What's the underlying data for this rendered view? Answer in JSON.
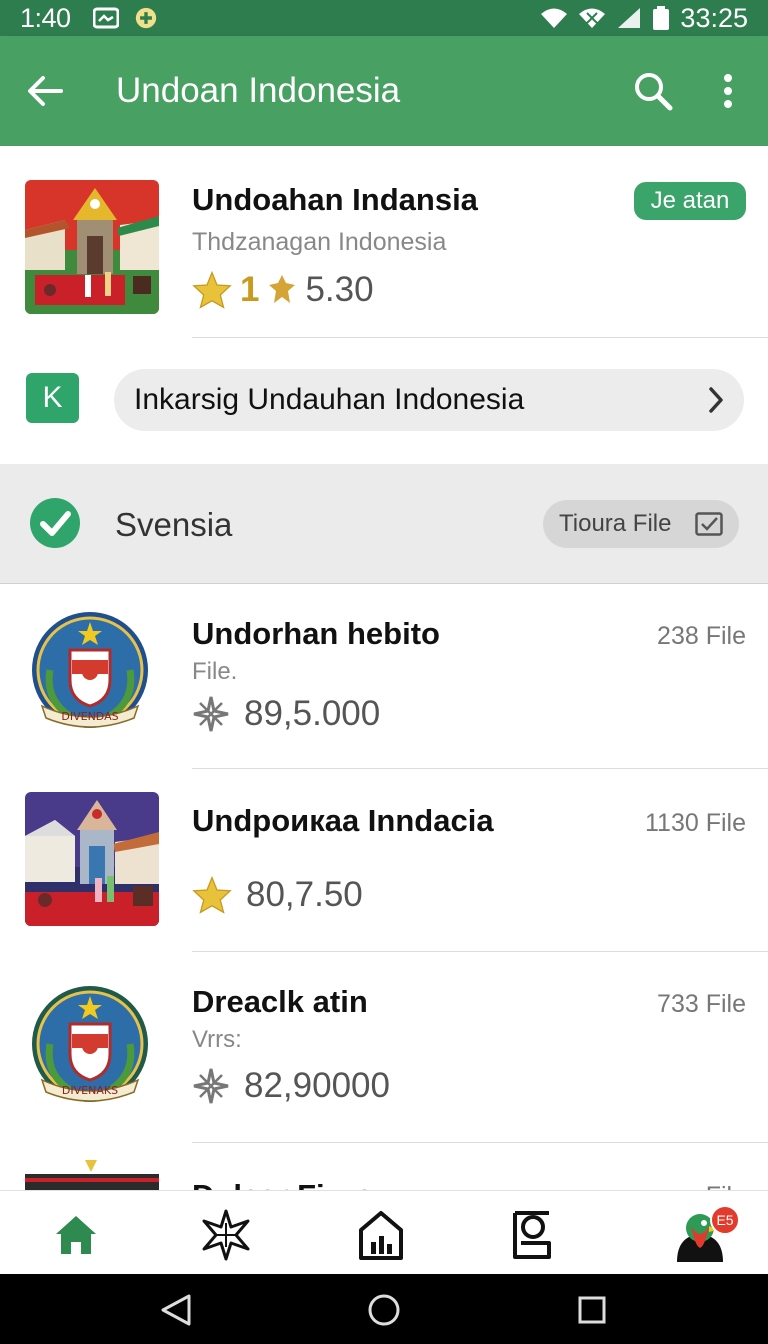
{
  "status_bar": {
    "time": "1:40",
    "clock": "33:25"
  },
  "app_bar": {
    "title": "Undoan Indonesia"
  },
  "featured": {
    "title": "Undoahan Indansia",
    "subtitle": "Thdzanagan Indonesia",
    "rating_prefix": "1",
    "rating_value": "5.30",
    "badge": "Je atan"
  },
  "link_row": {
    "icon_letter": "K",
    "label": "Inkarsig Undauhan Indonesia"
  },
  "section": {
    "title": "Svensia",
    "button_label": "Tioura File"
  },
  "items": [
    {
      "title": "Undorhan hebito",
      "subtitle": "File.",
      "value": "89,5.000",
      "count": "238 File",
      "emblem_text": "DIVENDAS"
    },
    {
      "title": "Undpoикaa Inndacia",
      "subtitle": "",
      "value": "80,7.50",
      "count": "1130 File"
    },
    {
      "title": "Dreaclk atin",
      "subtitle": "Vrrs:",
      "value": "82,90000",
      "count": "733 File",
      "emblem_text": "DIVENAKS"
    },
    {
      "title": "Dulear Fiкze",
      "count": "File"
    }
  ],
  "bottom_nav": {
    "notification_badge": "E5"
  },
  "colors": {
    "primary": "#48a063",
    "status": "#2e7d4f",
    "accent": "#2fa56b",
    "star": "#e8c23a"
  }
}
